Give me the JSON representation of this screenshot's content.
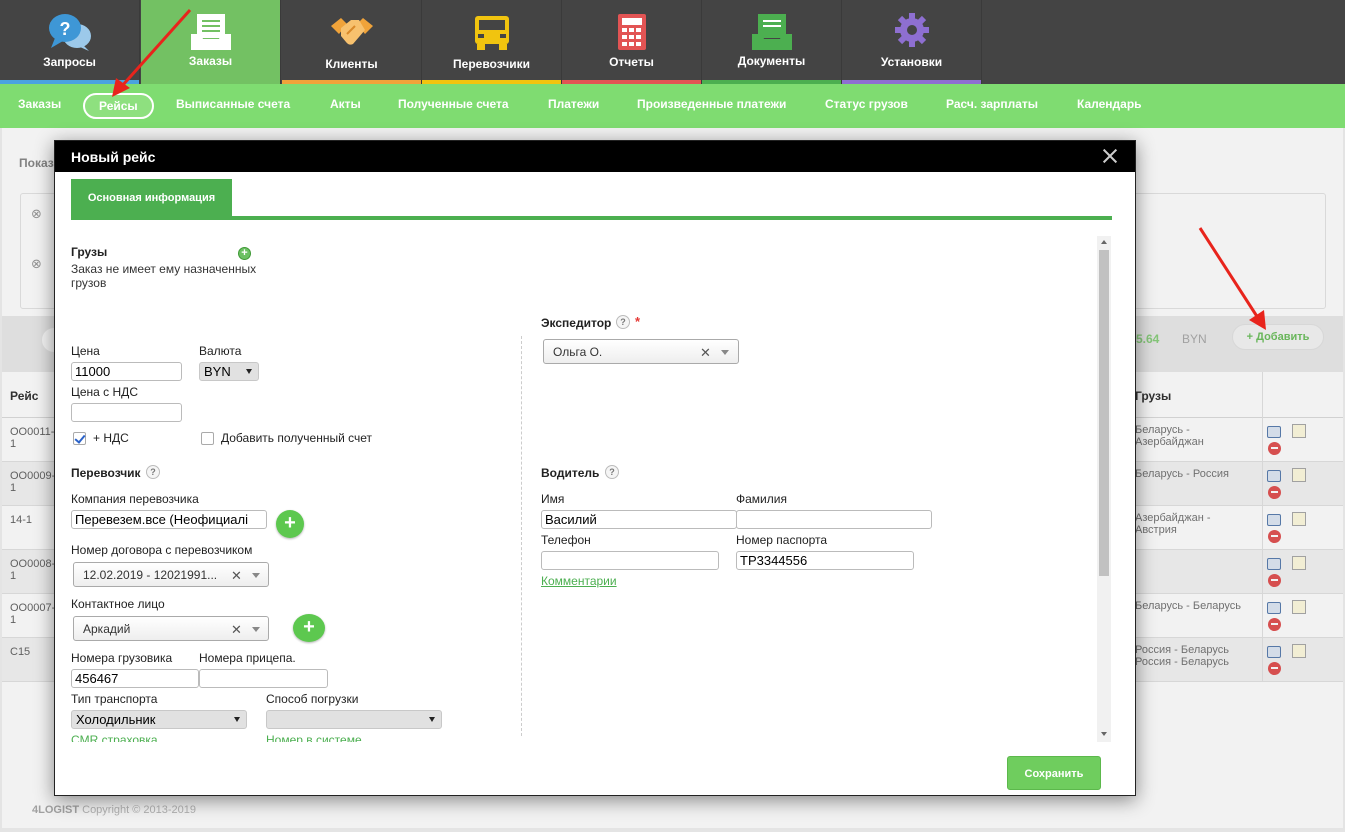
{
  "topnav": {
    "items": [
      {
        "label": "Запросы",
        "icon": "chat-bubbles-icon",
        "bar": "#4aa3df"
      },
      {
        "label": "Заказы",
        "icon": "orders-inbox-icon",
        "bar": "#73c163",
        "active": true
      },
      {
        "label": "Клиенты",
        "icon": "handshake-icon",
        "bar": "#f0a33a"
      },
      {
        "label": "Перевозчики",
        "icon": "truck-icon",
        "bar": "#f1c40f"
      },
      {
        "label": "Отчеты",
        "icon": "calculator-icon",
        "bar": "#e25454"
      },
      {
        "label": "Документы",
        "icon": "documents-tray-icon",
        "bar": "#4caf50"
      },
      {
        "label": "Установки",
        "icon": "gear-icon",
        "bar": "#8e6fd1"
      }
    ]
  },
  "subnav": {
    "items": [
      "Заказы",
      "Рейсы",
      "Выписанные счета",
      "Акты",
      "Полученные счета",
      "Платежи",
      "Произведенные платежи",
      "Статус грузов",
      "Расч. зарплаты",
      "Календарь"
    ]
  },
  "background": {
    "filter_label": "Показ",
    "total_value": "5.64",
    "total_currency": "BYN",
    "add_button": "Добавить",
    "table": {
      "col_trip": "Рейс",
      "col_cargo": "Грузы",
      "rows": [
        {
          "trip": "ОО0011-1",
          "cargo": "Беларусь - Азербайджан"
        },
        {
          "trip": "ОО0009-1",
          "cargo": "Беларусь - Россия"
        },
        {
          "trip": "14-1",
          "cargo": "Азербайджан - Австрия"
        },
        {
          "trip": "ОО0008-1",
          "cargo": ""
        },
        {
          "trip": "ОО0007-1",
          "cargo": "Беларусь - Беларусь"
        },
        {
          "trip": "С15",
          "cargo": "Россия - Беларусь\nРоссия - Беларусь"
        }
      ]
    },
    "footer_brand": "4LOGIST",
    "footer_copy": "Copyright © 2013-2019"
  },
  "modal": {
    "title": "Новый рейс",
    "tab": "Основная информация",
    "cargo_label": "Грузы",
    "cargo_note": "Заказ не имеет ему назначенных грузов",
    "price_label": "Цена",
    "price_value": "11000",
    "currency_label": "Валюта",
    "currency_value": "BYN",
    "price_vat_label": "Цена с НДС",
    "price_vat_value": "",
    "vat_checkbox": "+ НДС",
    "add_invoice_checkbox": "Добавить полученный счет",
    "carrier_label": "Перевозчик",
    "carrier_company_label": "Компания перевозчика",
    "carrier_company_value": "Перевезем.все (Неофициалі",
    "contract_label": "Номер договора с перевозчиком",
    "contract_value": "12.02.2019 - 12021991...",
    "contact_label": "Контактное лицо",
    "contact_value": "Аркадий",
    "truck_label": "Номера грузовика",
    "truck_value": "456467",
    "trailer_label": "Номера прицепа.",
    "trailer_value": "",
    "transport_type_label": "Тип транспорта",
    "transport_type_value": "Холодильник",
    "loading_label": "Способ погрузки",
    "loading_value": "",
    "cmr_link": "CMR страховка",
    "system_number_link": "Номер в системе",
    "forwarder_label": "Экспедитор",
    "forwarder_required": "*",
    "forwarder_value": "Ольга О.",
    "driver_label": "Водитель",
    "driver_name_label": "Имя",
    "driver_name_value": "Василий",
    "driver_surname_label": "Фамилия",
    "driver_surname_value": "",
    "driver_phone_label": "Телефон",
    "driver_phone_value": "",
    "driver_passport_label": "Номер паспорта",
    "driver_passport_value": "ТР3344556",
    "comments_link": "Комментарии",
    "save_button": "Сохранить"
  },
  "colors": {
    "accent_green": "#4caf50",
    "subnav_green": "#7fdc71",
    "topnav_bg": "#444444",
    "annotation_arrow": "#e8241c"
  }
}
